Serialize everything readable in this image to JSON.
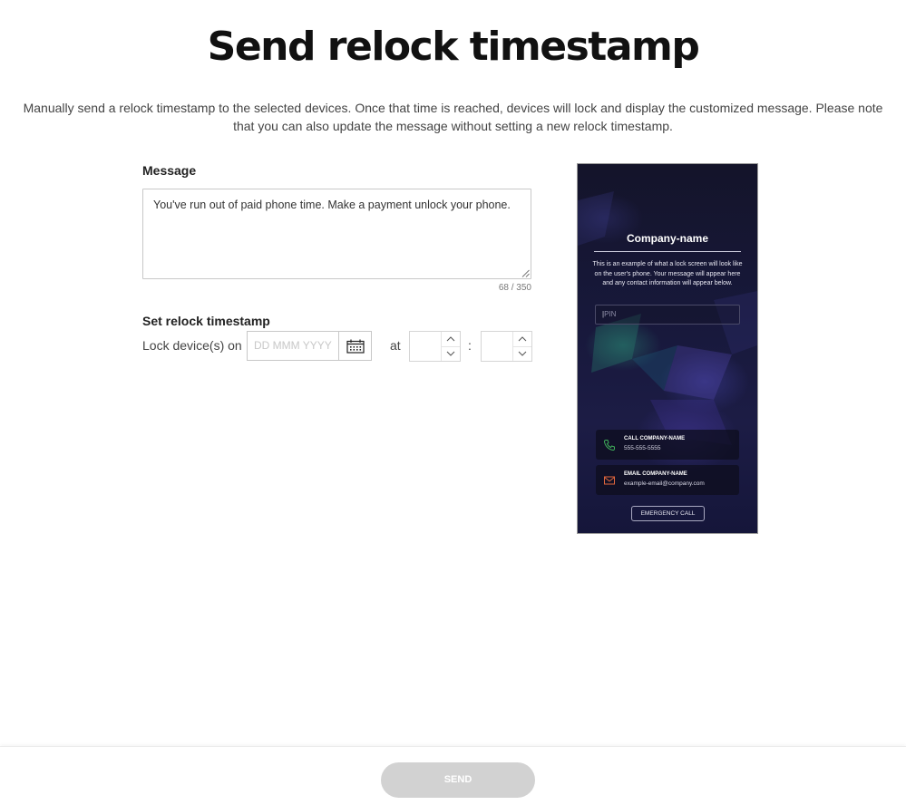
{
  "page": {
    "title": "Send relock timestamp",
    "description": "Manually send a relock timestamp to the selected devices. Once that time is reached, devices will lock and display the customized message. Please note that you can also update the message without setting a new relock timestamp."
  },
  "message": {
    "label": "Message",
    "value": "You've run out of paid phone time. Make a payment unlock your phone.",
    "char_count": "68 / 350"
  },
  "relock": {
    "label": "Set relock timestamp",
    "lock_on_label": "Lock device(s) on",
    "date_placeholder": "DD MMM YYYY",
    "at_label": "at",
    "time_separator": ":",
    "hour_value": "",
    "minute_value": ""
  },
  "preview": {
    "company_name": "Company-name",
    "note": "This is an example of what a lock screen will look like on the user's phone. Your message will appear here and any contact information will appear below.",
    "pin_placeholder": "PIN",
    "call_title": "CALL COMPANY-NAME",
    "call_detail": "555-555-5555",
    "email_title": "EMAIL COMPANY-NAME",
    "email_detail": "example-email@company.com",
    "emergency_label": "EMERGENCY CALL",
    "icons": {
      "call": "phone-icon",
      "email": "envelope-icon"
    },
    "colors": {
      "call_icon": "#3fae5a",
      "email_icon": "#e0663d"
    }
  },
  "footer": {
    "send_label": "SEND",
    "send_color": "#d2d2d2"
  }
}
